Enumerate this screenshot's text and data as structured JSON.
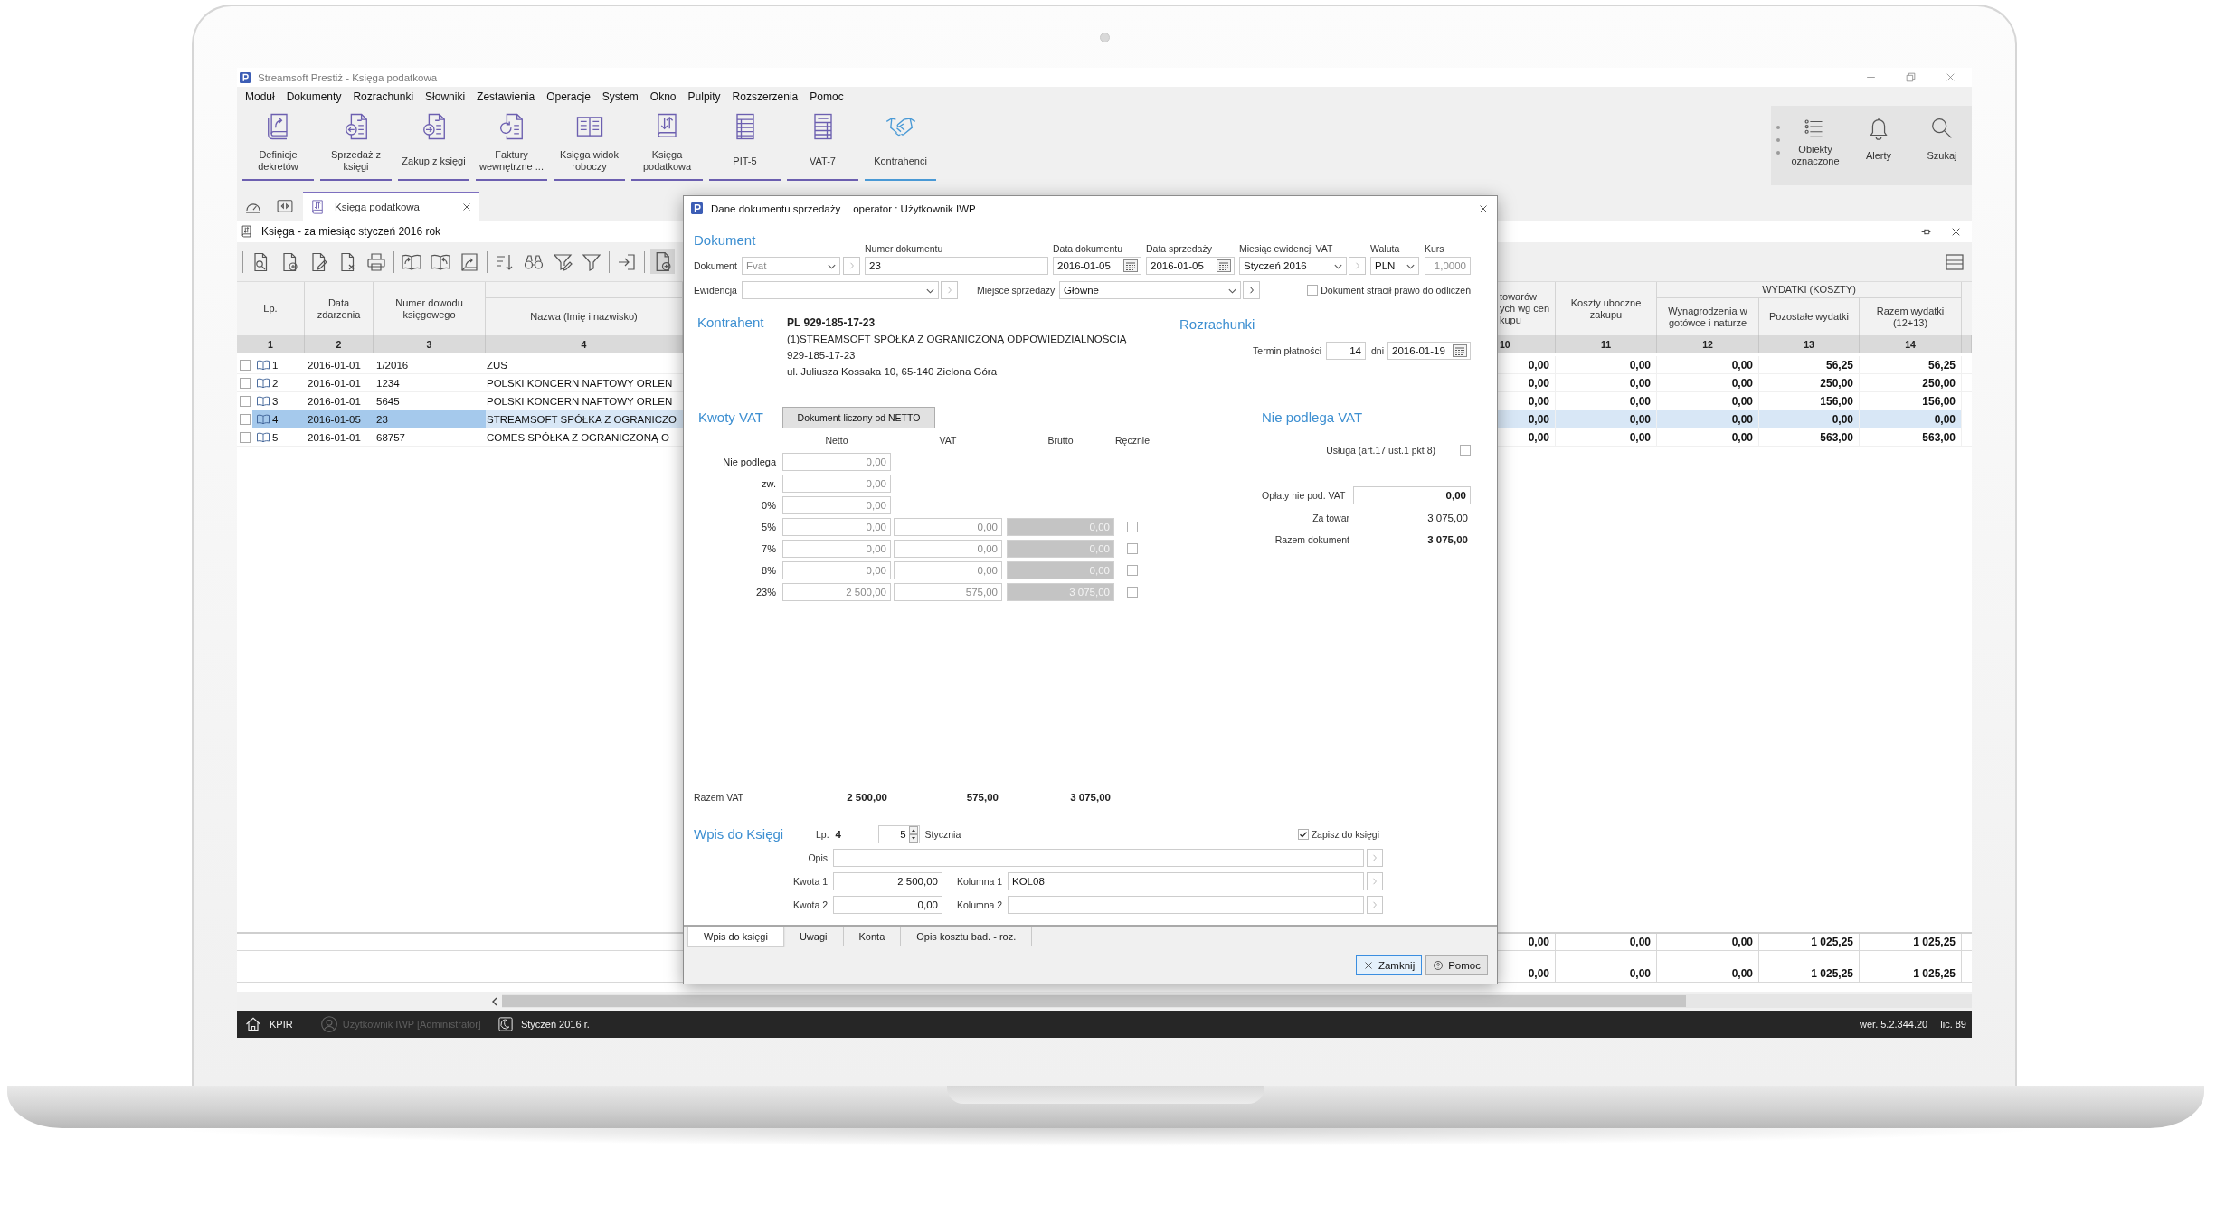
{
  "window": {
    "title": "Streamsoft Prestiż - Księga podatkowa"
  },
  "menu": [
    "Moduł",
    "Dokumenty",
    "Rozrachunki",
    "Słowniki",
    "Zestawienia",
    "Operacje",
    "System",
    "Okno",
    "Pulpity",
    "Rozszerzenia",
    "Pomoc"
  ],
  "ribbon": {
    "buttons": [
      {
        "label": "Definicje dekretów",
        "color": "#6c5fb0"
      },
      {
        "label": "Sprzedaż z księgi",
        "color": "#6c5fb0"
      },
      {
        "label": "Zakup z księgi",
        "color": "#6c5fb0"
      },
      {
        "label": "Faktury wewnętrzne ...",
        "color": "#6c5fb0"
      },
      {
        "label": "Księga widok roboczy",
        "color": "#6c5fb0"
      },
      {
        "label": "Księga podatkowa",
        "color": "#6c5fb0"
      },
      {
        "label": "PIT-5",
        "color": "#6c5fb0"
      },
      {
        "label": "VAT-7",
        "color": "#6c5fb0"
      },
      {
        "label": "Kontrahenci",
        "color": "#4a9ad6"
      }
    ],
    "side_buttons": [
      "Obiekty oznaczone",
      "Alerty",
      "Szukaj"
    ]
  },
  "document_tabs": [
    {
      "label": "Księga podatkowa",
      "selected": true
    }
  ],
  "ledger": {
    "title": "Księga - za miesiąc styczeń 2016 rok",
    "columns_left": [
      {
        "label": "Lp.",
        "number": "1"
      },
      {
        "label": "Data zdarzenia",
        "number": "2"
      },
      {
        "label": "Numer dowodu księgowego",
        "number": "3"
      },
      {
        "label": "Nazwa (Imię i nazwisko)",
        "number": "4"
      }
    ],
    "group_header": "WYDATKI (KOSZTY)",
    "columns_right": [
      {
        "label": "towarów\nych wg cen\nkupu",
        "number": "10"
      },
      {
        "label": "Koszty uboczne zakupu",
        "number": "11"
      },
      {
        "label": "Wynagrodzenia w gotówce i naturze",
        "number": "12"
      },
      {
        "label": "Pozostałe wydatki",
        "number": "13"
      },
      {
        "label": "Razem wydatki (12+13)",
        "number": "14"
      }
    ],
    "rows": [
      {
        "lp": "1",
        "date": "2016-01-01",
        "number": "1/2016",
        "name": "ZUS",
        "values": [
          "0,00",
          "0,00",
          "0,00",
          "56,25",
          "56,25"
        ],
        "checked": false,
        "selected": false
      },
      {
        "lp": "2",
        "date": "2016-01-01",
        "number": "1234",
        "name": "POLSKI KONCERN NAFTOWY ORLEN",
        "values": [
          "0,00",
          "0,00",
          "0,00",
          "250,00",
          "250,00"
        ],
        "checked": false,
        "selected": false
      },
      {
        "lp": "3",
        "date": "2016-01-01",
        "number": "5645",
        "name": "POLSKI KONCERN NAFTOWY ORLEN",
        "values": [
          "0,00",
          "0,00",
          "0,00",
          "156,00",
          "156,00"
        ],
        "checked": false,
        "selected": false
      },
      {
        "lp": "4",
        "date": "2016-01-05",
        "number": "23",
        "name": "STREAMSOFT SPÓŁKA Z OGRANICZO",
        "values": [
          "0,00",
          "0,00",
          "0,00",
          "0,00",
          "0,00"
        ],
        "checked": false,
        "selected": true
      },
      {
        "lp": "5",
        "date": "2016-01-01",
        "number": "68757",
        "name": "COMES SPÓŁKA Z OGRANICZONĄ O",
        "values": [
          "0,00",
          "0,00",
          "0,00",
          "563,00",
          "563,00"
        ],
        "checked": false,
        "selected": false
      }
    ],
    "totals": [
      {
        "values": [
          "0,00",
          "0,00",
          "0,00",
          "1 025,25",
          "1 025,25"
        ]
      },
      {
        "values": [
          "0,00",
          "0,00",
          "0,00",
          "1 025,25",
          "1 025,25"
        ]
      }
    ]
  },
  "status_bar": {
    "module": "KPIR",
    "user": "Użytkownik IWP [Administrator]",
    "period": "Styczeń 2016 r.",
    "version": "wer. 5.2.344.20",
    "license": "lic. 89"
  },
  "dialog": {
    "title": "Dane dokumentu sprzedaży",
    "operator": "operator : Użytkownik IWP",
    "document": {
      "heading": "Dokument",
      "type": {
        "label": "Dokument",
        "value": "Fvat",
        "disabled": true,
        "lookup_disabled": true
      },
      "number": {
        "label": "Numer dokumentu",
        "value": "23"
      },
      "document_date": {
        "label": "Data dokumentu",
        "value": "2016-01-05"
      },
      "sale_date": {
        "label": "Data sprzedaży",
        "value": "2016-01-05"
      },
      "vat_month": {
        "label": "Miesiąc ewidencji VAT",
        "value": "Styczeń 2016",
        "lookup_disabled": true
      },
      "currency": {
        "label": "Waluta",
        "value": "PLN"
      },
      "rate": {
        "label": "Kurs",
        "value": "1,0000",
        "disabled": true
      },
      "register": {
        "label": "Ewidencja",
        "lookup_disabled": true
      },
      "sale_place": {
        "label": "Miejsce sprzedaży",
        "value": "Główne",
        "lookup_disabled": false
      },
      "lost_deduction": {
        "label": "Dokument stracił prawo do odliczeń",
        "checked": false
      }
    },
    "contractor": {
      "heading": "Kontrahent",
      "tax_number": "PL 929-185-17-23",
      "name": "(1)STREAMSOFT SPÓŁKA Z OGRANICZONĄ ODPOWIEDZIALNOŚCIĄ",
      "nip": "929-185-17-23",
      "address": "ul. Juliusza Kossaka 10, 65-140 Zielona Góra"
    },
    "settlements": {
      "heading": "Rozrachunki",
      "term_label": "Termin płatności",
      "term_days": "14",
      "days_label": "dni",
      "due_date": "2016-01-19"
    },
    "vat": {
      "heading": "Kwoty VAT",
      "mode_button": "Dokument liczony od NETTO",
      "columns": [
        "Netto",
        "VAT",
        "Brutto",
        "Ręcznie"
      ],
      "rows": [
        {
          "kind": "net",
          "rate": "Nie podlega",
          "net": "0,00"
        },
        {
          "kind": "net",
          "rate": "zw.",
          "net": "0,00"
        },
        {
          "kind": "net",
          "rate": "0%",
          "net": "0,00"
        },
        {
          "kind": "full",
          "rate": "5%",
          "net": "0,00",
          "vat": "0,00",
          "gross": "0,00",
          "manual": false
        },
        {
          "kind": "full",
          "rate": "7%",
          "net": "0,00",
          "vat": "0,00",
          "gross": "0,00",
          "manual": false
        },
        {
          "kind": "full",
          "rate": "8%",
          "net": "0,00",
          "vat": "0,00",
          "gross": "0,00",
          "manual": false
        },
        {
          "kind": "full",
          "rate": "23%",
          "net": "2 500,00",
          "vat": "575,00",
          "gross": "3 075,00",
          "manual": false
        }
      ],
      "total_label": "Razem VAT",
      "total_net": "2 500,00",
      "total_vat": "575,00",
      "total_gross": "3 075,00"
    },
    "not_vat": {
      "heading": "Nie podlega VAT",
      "service": {
        "label": "Usługa (art.17 ust.1 pkt 8)",
        "checked": false
      },
      "fees": {
        "label": "Opłaty nie pod. VAT",
        "value": "0,00"
      },
      "goods": {
        "label": "Za towar",
        "value": "3 075,00"
      },
      "total": {
        "label": "Razem dokument",
        "value": "3 075,00"
      }
    },
    "ledger_entry": {
      "heading": "Wpis do Księgi",
      "lp": {
        "label": "Lp.",
        "value": "4"
      },
      "day": "5",
      "month": "Stycznia",
      "save": {
        "label": "Zapisz do księgi",
        "checked": true
      },
      "description": {
        "label": "Opis",
        "lookup_disabled": true
      },
      "amount_1": {
        "label": "Kwota 1",
        "value": "2 500,00"
      },
      "column_1": {
        "label": "Kolumna 1",
        "value": "KOL08",
        "lookup_disabled": true
      },
      "amount_2": {
        "label": "Kwota 2",
        "value": "0,00"
      },
      "column_2": {
        "label": "Kolumna 2",
        "lookup_disabled": true
      }
    },
    "tabs": [
      {
        "label": "Wpis do księgi",
        "selected": true
      },
      {
        "label": "Uwagi",
        "selected": false
      },
      {
        "label": "Konta",
        "selected": false
      },
      {
        "label": "Opis kosztu bad. - roz.",
        "selected": false
      }
    ],
    "buttons": [
      {
        "kind": "close",
        "label": "Zamknij",
        "focused": true
      },
      {
        "kind": "help",
        "label": "Pomoc",
        "focused": false
      }
    ]
  }
}
